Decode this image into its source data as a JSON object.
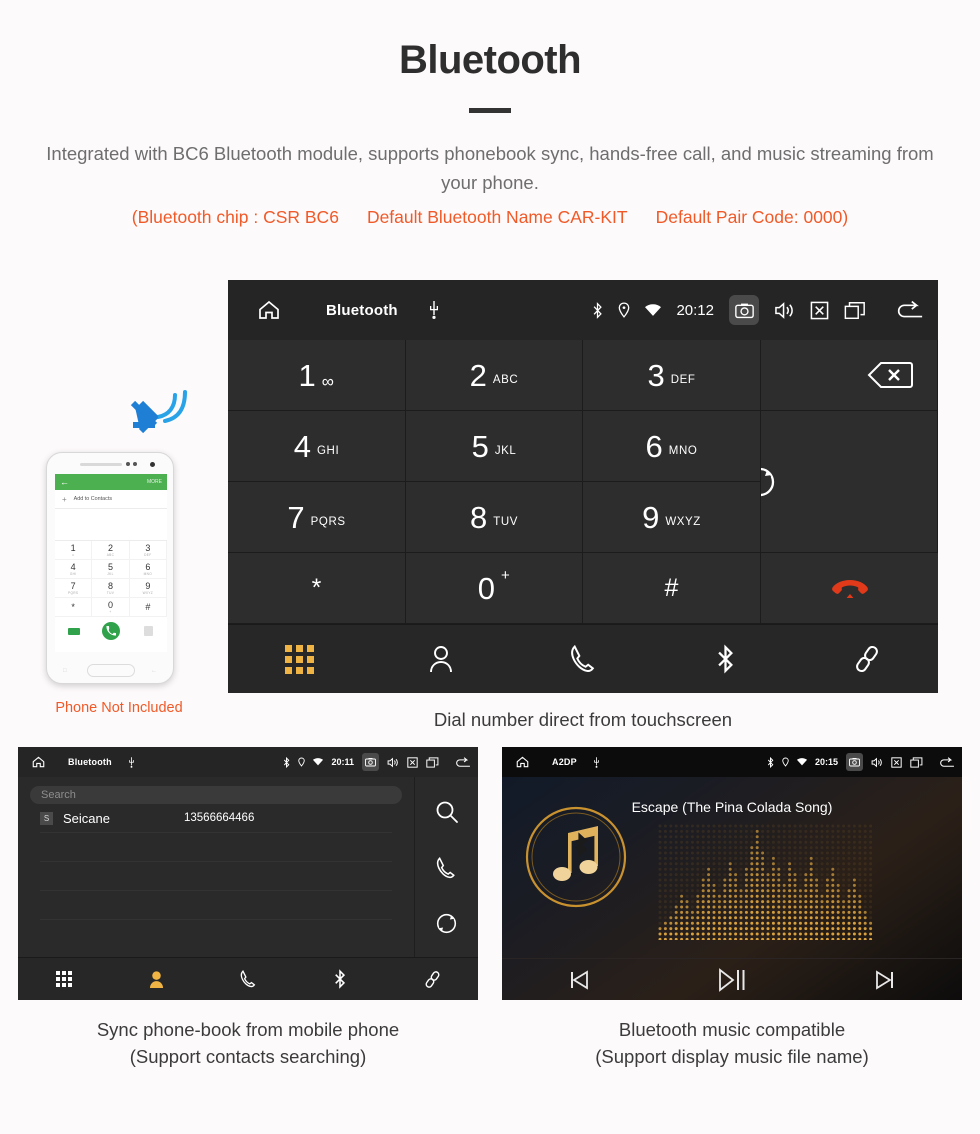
{
  "header": {
    "title": "Bluetooth",
    "description": "Integrated with BC6 Bluetooth module, supports phonebook sync, hands-free call, and music streaming from your phone.",
    "spec_chip": "(Bluetooth chip : CSR BC6",
    "spec_name": "Default Bluetooth Name CAR-KIT",
    "spec_pair": "Default Pair Code: 0000)",
    "accent_color": "#f05a28",
    "text_color": "#6e6e6e"
  },
  "dialer": {
    "statusbar": {
      "title": "Bluetooth",
      "time": "20:12",
      "icons_left": [
        "home-icon",
        "usb-icon"
      ],
      "icons_right": [
        "bluetooth-icon",
        "location-icon",
        "wifi-icon",
        "camera-icon",
        "volume-icon",
        "close-icon",
        "recents-icon",
        "back-icon"
      ]
    },
    "keys": [
      {
        "num": "1",
        "sub": "∞",
        "name": "key-1"
      },
      {
        "num": "2",
        "sub": "ABC",
        "name": "key-2"
      },
      {
        "num": "3",
        "sub": "DEF",
        "name": "key-3"
      },
      {
        "num": "4",
        "sub": "GHI",
        "name": "key-4"
      },
      {
        "num": "5",
        "sub": "JKL",
        "name": "key-5"
      },
      {
        "num": "6",
        "sub": "MNO",
        "name": "key-6"
      },
      {
        "num": "7",
        "sub": "PQRS",
        "name": "key-7"
      },
      {
        "num": "8",
        "sub": "TUV",
        "name": "key-8"
      },
      {
        "num": "9",
        "sub": "WXYZ",
        "name": "key-9"
      },
      {
        "num": "*",
        "sub": "",
        "name": "key-star"
      },
      {
        "num": "0",
        "sub": "+",
        "name": "key-0"
      },
      {
        "num": "#",
        "sub": "",
        "name": "key-hash"
      }
    ],
    "actions": {
      "backspace": "backspace-icon",
      "sync": "sync-icon",
      "call": "call-icon",
      "hangup": "hangup-icon",
      "call_color": "#14c13a",
      "hangup_color": "#e03a1a"
    },
    "bottom_nav": [
      "dialpad",
      "contacts",
      "call-log",
      "bluetooth",
      "link"
    ],
    "active_nav": "dialpad",
    "active_color": "#f0b445",
    "caption": "Dial number direct from touchscreen"
  },
  "phone_mockup": {
    "app_bar_more": "MORE",
    "add_to_contacts": "Add to Contacts",
    "keys": [
      {
        "num": "1",
        "sub": "∞"
      },
      {
        "num": "2",
        "sub": "ABC"
      },
      {
        "num": "3",
        "sub": "DEF"
      },
      {
        "num": "4",
        "sub": "GHI"
      },
      {
        "num": "5",
        "sub": "JKL"
      },
      {
        "num": "6",
        "sub": "MNO"
      },
      {
        "num": "7",
        "sub": "PQRS"
      },
      {
        "num": "8",
        "sub": "TUV"
      },
      {
        "num": "9",
        "sub": "WXYZ"
      },
      {
        "num": "*",
        "sub": ""
      },
      {
        "num": "0",
        "sub": "+"
      },
      {
        "num": "#",
        "sub": ""
      }
    ],
    "not_included_label": "Phone Not Included",
    "bar_color": "#4caf50"
  },
  "phonebook": {
    "statusbar": {
      "title": "Bluetooth",
      "time": "20:11"
    },
    "search_placeholder": "Search",
    "contacts": [
      {
        "badge": "S",
        "name": "Seicane",
        "number": "13566664466"
      }
    ],
    "side_actions": [
      "search-icon",
      "call-icon",
      "sync-icon"
    ],
    "bottom_nav": [
      "dialpad",
      "contacts",
      "call-log",
      "bluetooth",
      "link"
    ],
    "active_nav": "contacts",
    "caption_line1": "Sync phone-book from mobile phone",
    "caption_line2": "(Support contacts searching)"
  },
  "music": {
    "statusbar": {
      "title": "A2DP",
      "time": "20:15"
    },
    "track_title": "Escape (The Pina Colada Song)",
    "controls": [
      "previous",
      "play-pause",
      "next"
    ],
    "accent_color": "#c9922f",
    "caption_line1": "Bluetooth music compatible",
    "caption_line2": "(Support display music file name)"
  }
}
